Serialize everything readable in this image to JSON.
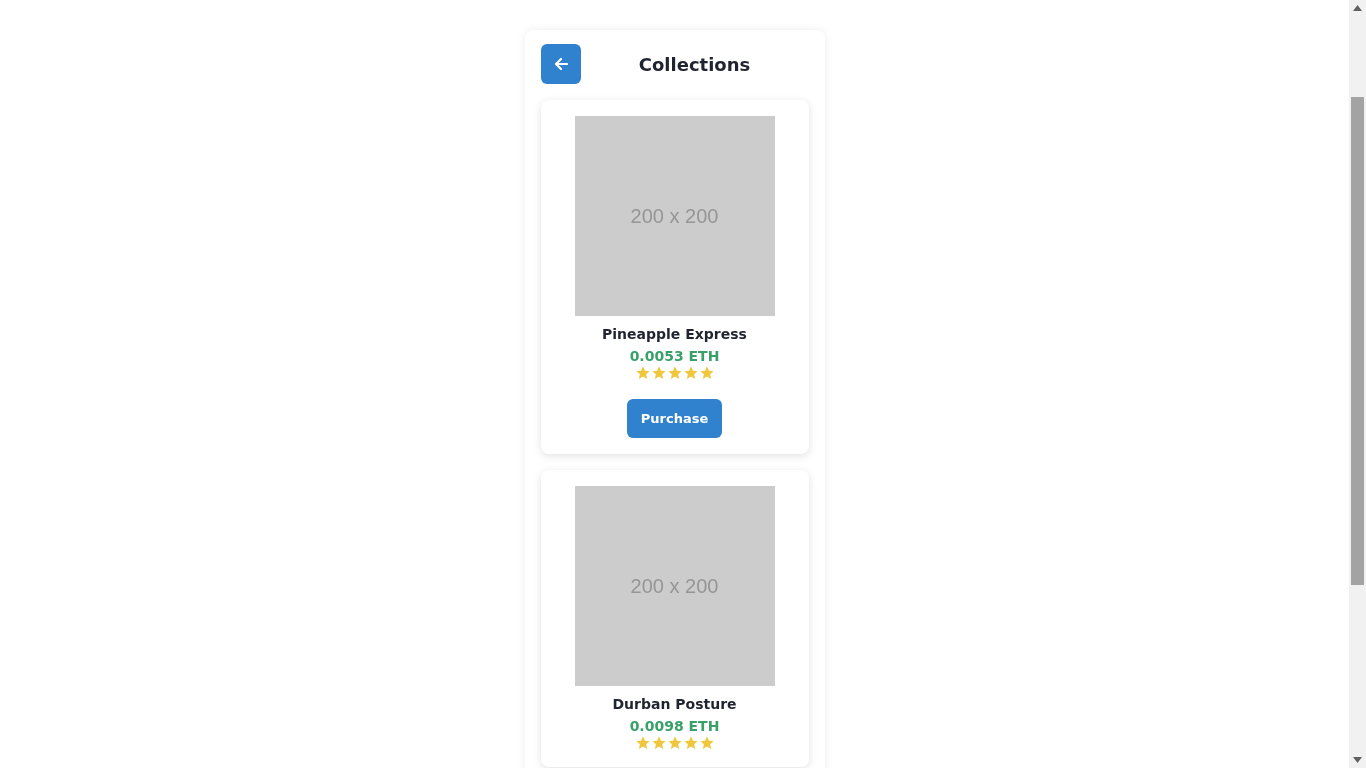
{
  "header": {
    "title": "Collections"
  },
  "products": [
    {
      "image_label": "200 x 200",
      "name": "Pineapple Express",
      "price": "0.0053 ETH",
      "stars": 5,
      "button": "Purchase"
    },
    {
      "image_label": "200 x 200",
      "name": "Durban Posture",
      "price": "0.0098 ETH",
      "stars": 5
    }
  ]
}
